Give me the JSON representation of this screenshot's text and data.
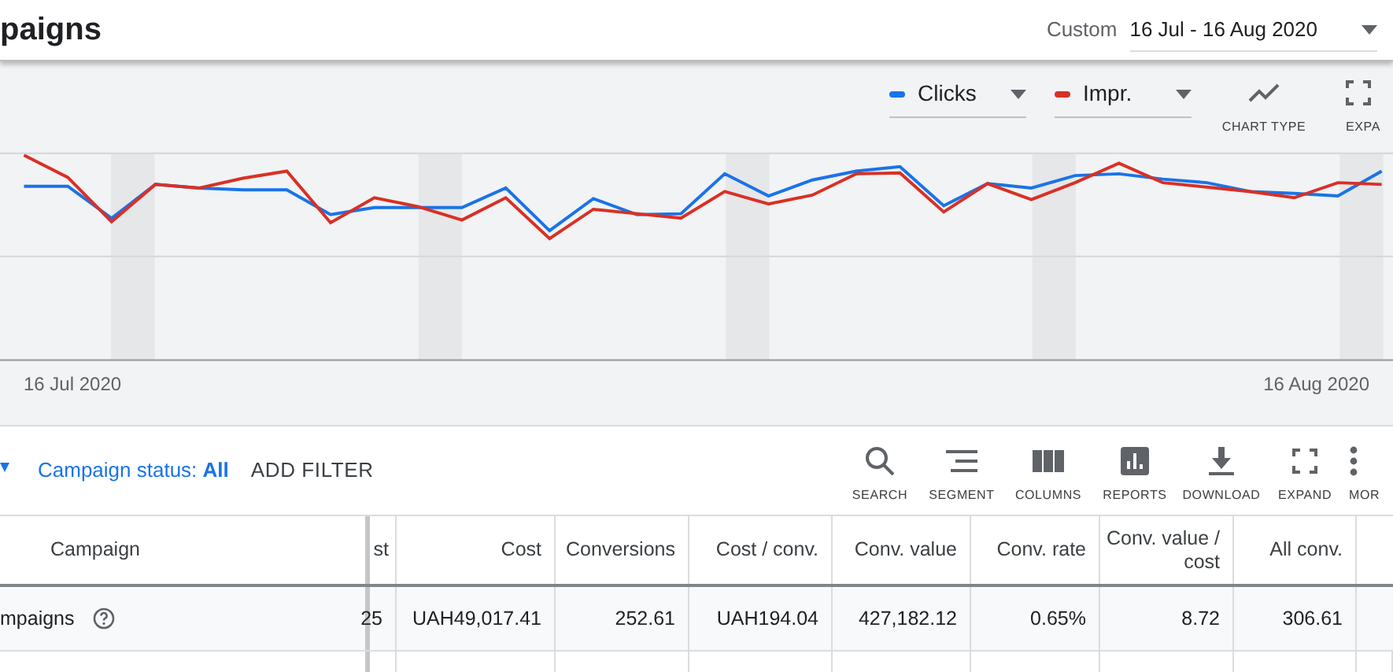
{
  "header": {
    "title": "paigns",
    "date_label": "Custom",
    "date_range": "16 Jul - 16 Aug 2020"
  },
  "chart": {
    "metrics": [
      {
        "label": "Clicks",
        "color": "#1a73e8"
      },
      {
        "label": "Impr.",
        "color": "#d93025"
      }
    ],
    "tools": [
      {
        "kind": "chart-type",
        "label": "CHART TYPE"
      },
      {
        "kind": "expand",
        "label": "EXPA"
      }
    ],
    "start_label": "16 Jul 2020",
    "end_label": "16 Aug 2020"
  },
  "filter": {
    "status_label": "Campaign status:",
    "status_value": "All",
    "add_filter": "ADD FILTER"
  },
  "toolbar": [
    {
      "kind": "search",
      "label": "SEARCH"
    },
    {
      "kind": "segment",
      "label": "SEGMENT"
    },
    {
      "kind": "columns",
      "label": "COLUMNS"
    },
    {
      "kind": "reports",
      "label": "REPORTS"
    },
    {
      "kind": "download",
      "label": "DOWNLOAD"
    },
    {
      "kind": "expand",
      "label": "EXPAND"
    },
    {
      "kind": "more",
      "label": "MOR"
    }
  ],
  "table": {
    "columns": [
      "Campaign",
      "st",
      "Cost",
      "Conversions",
      "Cost / conv.",
      "Conv. value",
      "Conv. rate",
      "Conv. value / cost",
      "All conv."
    ],
    "rows": [
      {
        "cells": [
          "mpaigns",
          "25",
          "UAH49,017.41",
          "252.61",
          "UAH194.04",
          "427,182.12",
          "0.65%",
          "8.72",
          "306.61"
        ]
      }
    ]
  }
}
